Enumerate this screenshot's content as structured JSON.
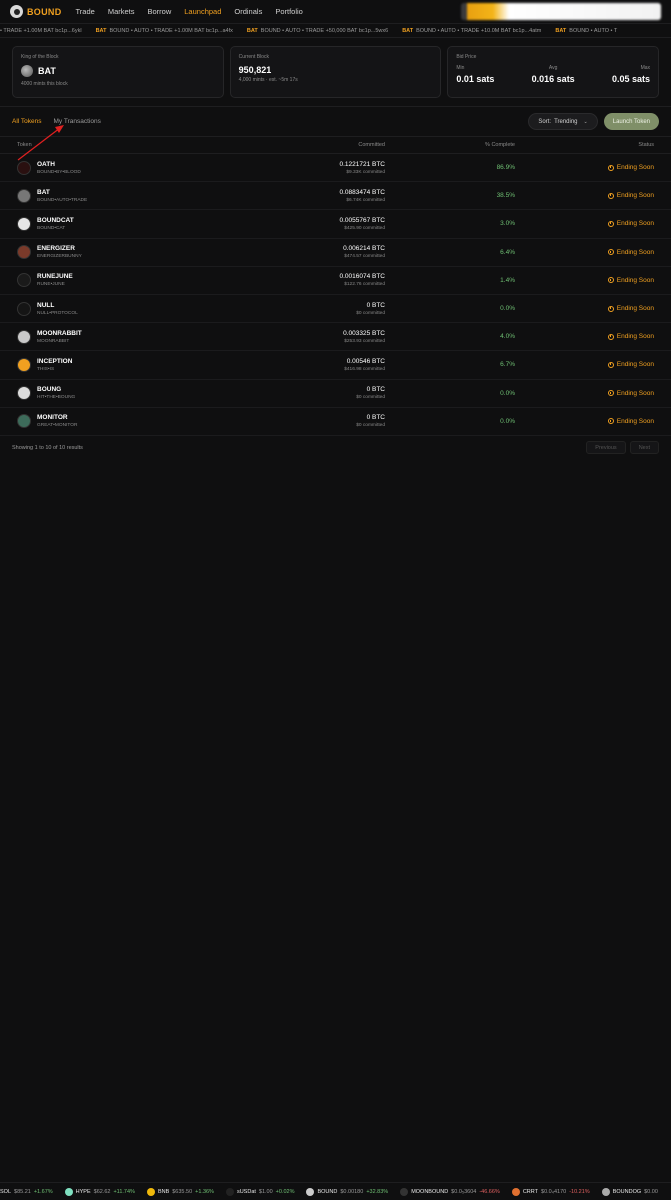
{
  "brand": {
    "name": "BOUND"
  },
  "nav": [
    {
      "label": "Trade",
      "active": false
    },
    {
      "label": "Markets",
      "active": false
    },
    {
      "label": "Borrow",
      "active": false
    },
    {
      "label": "Launchpad",
      "active": true
    },
    {
      "label": "Ordinals",
      "active": false
    },
    {
      "label": "Portfolio",
      "active": false
    }
  ],
  "ticker": [
    {
      "sym": "",
      "text": "• TRADE +1.00M BAT bc1p...6ykl"
    },
    {
      "sym": "BAT",
      "text": "BOUND • AUTO • TRADE +1.00M BAT bc1p...a4fx"
    },
    {
      "sym": "BAT",
      "text": "BOUND • AUTO • TRADE +50,000 BAT bc1p...5wx6"
    },
    {
      "sym": "BAT",
      "text": "BOUND • AUTO • TRADE +10.0M BAT bc1p...4atm"
    },
    {
      "sym": "BAT",
      "text": "BOUND • AUTO • T"
    }
  ],
  "stats": {
    "king": {
      "label": "King of the Block",
      "value": "BAT",
      "sub": "4000 mints this block"
    },
    "block": {
      "label": "Current Block",
      "value": "950,821",
      "sub": "4,000 mints · est. ~5m 17s"
    },
    "bid": {
      "label": "Bid Price",
      "min_label": "Min",
      "min": "0.01 sats",
      "avg_label": "Avg",
      "avg": "0.016 sats",
      "max_label": "Max",
      "max": "0.05 sats"
    }
  },
  "tabs": [
    {
      "label": "All Tokens",
      "active": true
    },
    {
      "label": "My Transactions",
      "active": false
    }
  ],
  "sort": {
    "label": "Sort:",
    "value": "Trending"
  },
  "launch_button": "Launch Token",
  "table": {
    "headers": {
      "token": "Token",
      "committed": "Committed",
      "pct": "% Complete",
      "status": "Status"
    },
    "rows": [
      {
        "name": "OATH",
        "sub": "BOUND•BY•BLOOD",
        "btc": "0.1221721 BTC",
        "usd": "$9.33K committed",
        "pct": "86.9%",
        "status": "Ending Soon",
        "icon_color": "#2a1010"
      },
      {
        "name": "BAT",
        "sub": "BOUND•AUTO•TRADE",
        "btc": "0.0883474 BTC",
        "usd": "$6.74K committed",
        "pct": "38.5%",
        "status": "Ending Soon",
        "icon_color": "#777777"
      },
      {
        "name": "BOUNDCAT",
        "sub": "BOUND•CAT",
        "btc": "0.0055767 BTC",
        "usd": "$425.90 committed",
        "pct": "3.0%",
        "status": "Ending Soon",
        "icon_color": "#e6e6e6"
      },
      {
        "name": "ENERGIZER",
        "sub": "ENERGIZERBUNNY",
        "btc": "0.006214 BTC",
        "usd": "$474.57 committed",
        "pct": "6.4%",
        "status": "Ending Soon",
        "icon_color": "#7a3a2a"
      },
      {
        "name": "RUNEJUNE",
        "sub": "RUNE•JUNE",
        "btc": "0.0016074 BTC",
        "usd": "$122.76 committed",
        "pct": "1.4%",
        "status": "Ending Soon",
        "icon_color": "#1a1a1a"
      },
      {
        "name": "NULL",
        "sub": "NULL•PROTOCOL",
        "btc": "0 BTC",
        "usd": "$0 committed",
        "pct": "0.0%",
        "status": "Ending Soon",
        "icon_color": "#151515"
      },
      {
        "name": "MOONRABBIT",
        "sub": "MOONRABBIT",
        "btc": "0.003325 BTC",
        "usd": "$253.93 committed",
        "pct": "4.0%",
        "status": "Ending Soon",
        "icon_color": "#c9c9c9"
      },
      {
        "name": "INCEPTION",
        "sub": "THIS•IS",
        "btc": "0.00546 BTC",
        "usd": "$416.98 committed",
        "pct": "6.7%",
        "status": "Ending Soon",
        "icon_color": "#f0a020"
      },
      {
        "name": "BOUNG",
        "sub": "HIT•THE•BOUNG",
        "btc": "0 BTC",
        "usd": "$0 committed",
        "pct": "0.0%",
        "status": "Ending Soon",
        "icon_color": "#dddddd"
      },
      {
        "name": "MONITOR",
        "sub": "GREAT•MONITOR",
        "btc": "0 BTC",
        "usd": "$0 committed",
        "pct": "0.0%",
        "status": "Ending Soon",
        "icon_color": "#3d6b5a"
      }
    ]
  },
  "footer": {
    "results": "Showing 1 to 10 of 10 results",
    "prev": "Previous",
    "next": "Next"
  },
  "bottom_ticker": [
    {
      "sym": "SOL",
      "price": "$85.21",
      "change": "+1.67%",
      "dir": "up",
      "icon": "#6a4cff"
    },
    {
      "sym": "HYPE",
      "price": "$62.62",
      "change": "+11.74%",
      "dir": "up",
      "icon": "#7fe0c0"
    },
    {
      "sym": "BNB",
      "price": "$635.50",
      "change": "+1.36%",
      "dir": "up",
      "icon": "#f0b90b"
    },
    {
      "sym": "sUSDat",
      "price": "$1.00",
      "change": "+0.02%",
      "dir": "up",
      "icon": "#222222"
    },
    {
      "sym": "BOUND",
      "price": "$0.00180",
      "change": "+32.83%",
      "dir": "up",
      "icon": "#cccccc"
    },
    {
      "sym": "MOONBOUND",
      "price": "$0.0₅3604",
      "change": "-46.66%",
      "dir": "down",
      "icon": "#333333"
    },
    {
      "sym": "CRRT",
      "price": "$0.0₄4170",
      "change": "-10.21%",
      "dir": "down",
      "icon": "#e07030"
    },
    {
      "sym": "BOUNDOG",
      "price": "$0.00",
      "change": "",
      "dir": "up",
      "icon": "#aaaaaa"
    }
  ],
  "colors": {
    "accent": "#f0a020",
    "positive": "#6fbf73",
    "negative": "#e06060",
    "launch": "#7f8f68"
  }
}
